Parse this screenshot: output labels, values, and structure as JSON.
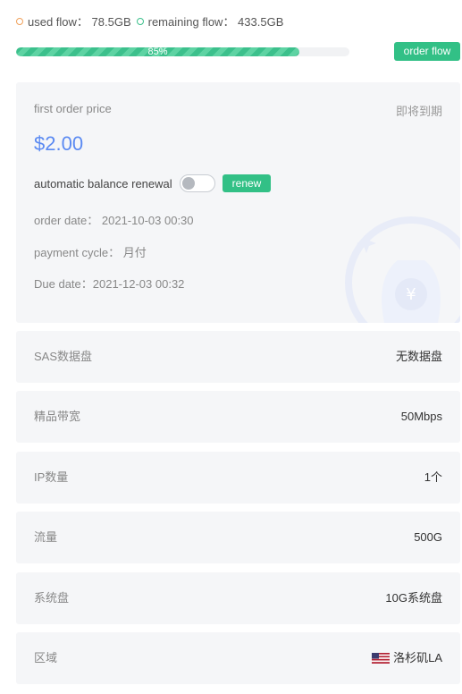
{
  "flow": {
    "used_label": "used flow： 78.5GB",
    "remaining_label": "remaining flow： 433.5GB",
    "used_percent": 85,
    "progress_text": "85%",
    "order_flow_button": "order flow",
    "colors": {
      "used": "#f0a05a",
      "remaining": "#3cc08c"
    }
  },
  "card": {
    "first_price_label": "first order price",
    "status": "即将到期",
    "price": "$2.00",
    "auto_renew_label": "automatic balance renewal",
    "auto_renew_on": false,
    "renew_button": "renew",
    "order_date": "order date： 2021-10-03 00:30",
    "payment_cycle": "payment cycle： 月付",
    "due_date": "Due date：2021-12-03 00:32"
  },
  "specs": [
    {
      "label": "SAS数据盘",
      "value": "无数据盘"
    },
    {
      "label": "精品带宽",
      "value": "50Mbps"
    },
    {
      "label": "IP数量",
      "value": "1个"
    },
    {
      "label": "流量",
      "value": "500G"
    },
    {
      "label": "系统盘",
      "value": "10G系统盘"
    },
    {
      "label": "区域",
      "value": "洛杉矶LA",
      "icon": "us-flag-icon"
    }
  ],
  "accent": "#32c086",
  "price_color": "#5b8af2"
}
